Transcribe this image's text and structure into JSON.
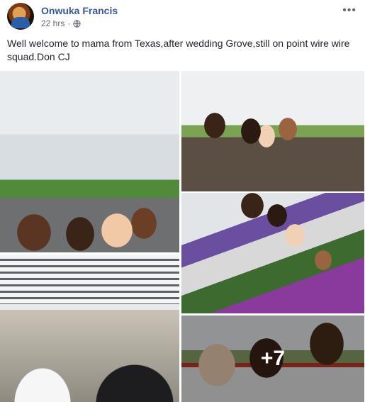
{
  "post": {
    "author": "Onwuka Francis",
    "time": "22 hrs",
    "audience_icon": "globe-icon",
    "options_label": "•••",
    "text": "Well welcome to mama from Texas,after wedding Grove,still on point wire wire squad.Don CJ"
  },
  "photos": {
    "more_count": "+7"
  },
  "colors": {
    "author_link": "#365899",
    "meta_text": "#616770",
    "body_text": "#1d2129"
  }
}
